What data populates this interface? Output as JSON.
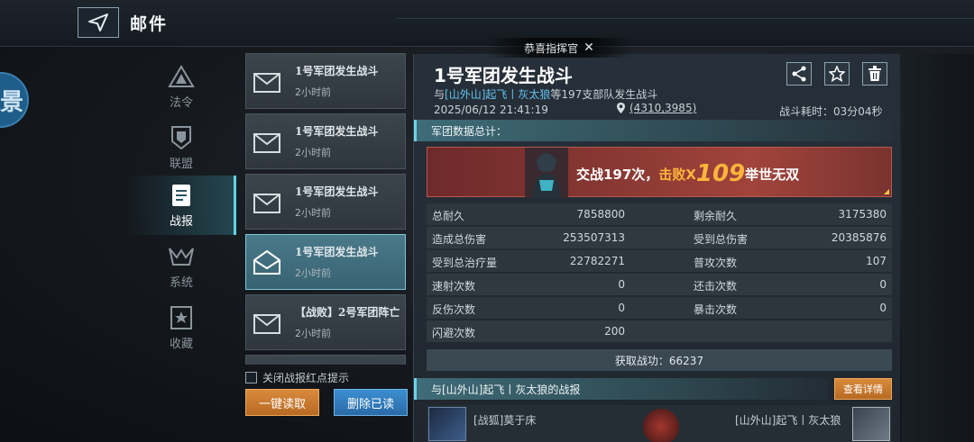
{
  "header": {
    "title": "邮件"
  },
  "left_circle_text": "景",
  "toast": {
    "text": "恭喜指挥官"
  },
  "sidebar": {
    "items": [
      {
        "label": "法令",
        "icon": "decree-icon"
      },
      {
        "label": "联盟",
        "icon": "alliance-icon"
      },
      {
        "label": "战报",
        "icon": "battle-report-icon",
        "active": true
      },
      {
        "label": "系统",
        "icon": "system-icon"
      },
      {
        "label": "收藏",
        "icon": "favorite-icon"
      }
    ]
  },
  "mails": [
    {
      "title": "1号军团发生战斗",
      "time": "2小时前"
    },
    {
      "title": "1号军团发生战斗",
      "time": "2小时前"
    },
    {
      "title": "1号军团发生战斗",
      "time": "2小时前"
    },
    {
      "title": "1号军团发生战斗",
      "time": "2小时前",
      "active": true
    },
    {
      "title": "【战败】2号军团阵亡",
      "time": "2小时前"
    }
  ],
  "list_footer": {
    "checkbox_label": "关闭战报红点提示",
    "read_all": "一键读取",
    "delete_read": "删除已读"
  },
  "detail": {
    "title": "1号军团发生战斗",
    "subtitle_prefix": "与",
    "subtitle_enemy": "[山外山]起飞丨灰太狼",
    "subtitle_suffix": "等197支部队发生战斗",
    "date": "2025/06/12  21:41:19",
    "coords": "(4310,3985)",
    "duration_label": "战斗耗时：",
    "duration": "03分04秒",
    "section_total": "军团数据总计：",
    "banner": {
      "prefix": "交战197次，",
      "kill_label": "击败X",
      "kill_num": "109",
      "suffix": "举世无双"
    },
    "stats": [
      {
        "l_label": "总耐久",
        "l_value": "7858800",
        "r_label": "剩余耐久",
        "r_value": "3175380"
      },
      {
        "l_label": "造成总伤害",
        "l_value": "253507313",
        "r_label": "受到总伤害",
        "r_value": "20385876"
      },
      {
        "l_label": "受到总治疗量",
        "l_value": "22782271",
        "r_label": "普攻次数",
        "r_value": "107"
      },
      {
        "l_label": "速射次数",
        "l_value": "0",
        "r_label": "还击次数",
        "r_value": "0"
      },
      {
        "l_label": "反伤次数",
        "l_value": "0",
        "r_label": "暴击次数",
        "r_value": "0"
      },
      {
        "l_label": "闪避次数",
        "l_value": "200",
        "r_label": "",
        "r_value": ""
      }
    ],
    "gain": "获取战功：66237",
    "section_vs": "与[山外山]起飞丨灰太狼的战报",
    "view_details": "查看详情",
    "bottom_left": "[战狐]莫于床",
    "bottom_right": "[山外山]起飞丨灰太狼"
  }
}
